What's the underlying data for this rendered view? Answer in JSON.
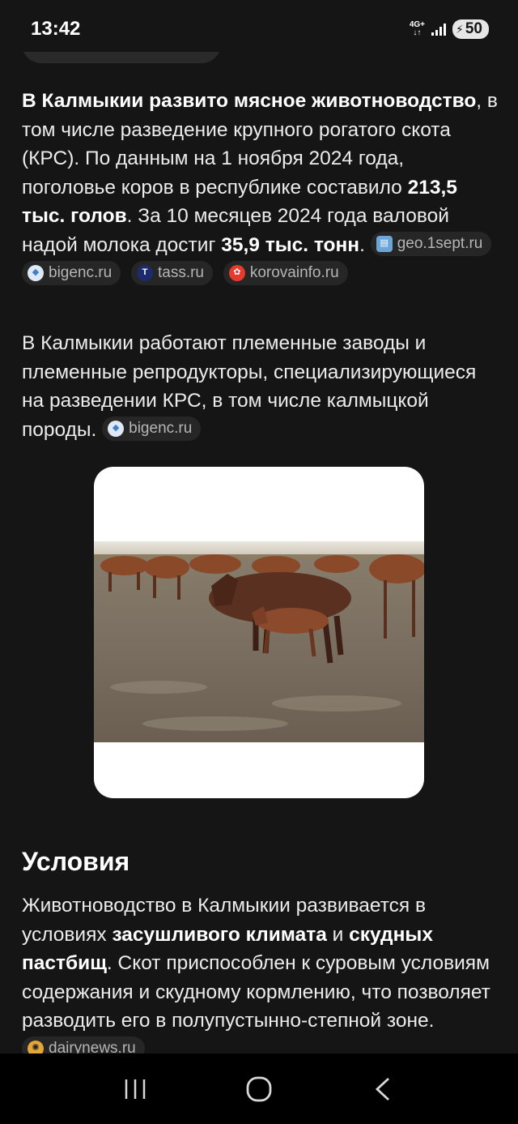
{
  "status": {
    "time": "13:42",
    "network": "4G+",
    "battery": "50",
    "icons": [
      "signal-icon",
      "battery-icon"
    ]
  },
  "article": {
    "p1": {
      "b1": "В Калмыкии развито мясное животноводство",
      "t1": ", в том числе разведение крупного рогатого скота (КРС). По данным на 1 ноября 2024 года, поголовье коров в республике составило ",
      "b2": "213,5 тыс. голов",
      "t2": ". За 10 месяцев 2024 года валовой надой молока достиг ",
      "b3": "35,9 тыс. тонн",
      "t3": ".",
      "sources": [
        "geo.1sept.ru",
        "bigenc.ru",
        "tass.ru",
        "korovainfo.ru"
      ]
    },
    "p2": {
      "text": "В Калмыкии работают племенные заводы и племенные репродукторы, специализирующиеся на разведении КРС, в том числе калмыцкой породы.",
      "source": "bigenc.ru"
    },
    "image_description_name": "cattle-photo",
    "heading": "Условия",
    "p3": {
      "t1": "Животноводство в Калмыкии развивается в условиях ",
      "b1": "засушливого климата",
      "t2": " и ",
      "b2": "скудных пастбищ",
      "t3": ". Скот приспособлен к суровым условиям содержания и скудному кормлению, что позволяет разводить его в полупустынно-степной зоне.",
      "source": "dairynews.ru"
    }
  },
  "colors": {
    "background": "#151515",
    "chip": "#262626",
    "text": "#ececec"
  },
  "navigation": [
    "recent-apps-icon",
    "home-icon",
    "back-icon"
  ]
}
